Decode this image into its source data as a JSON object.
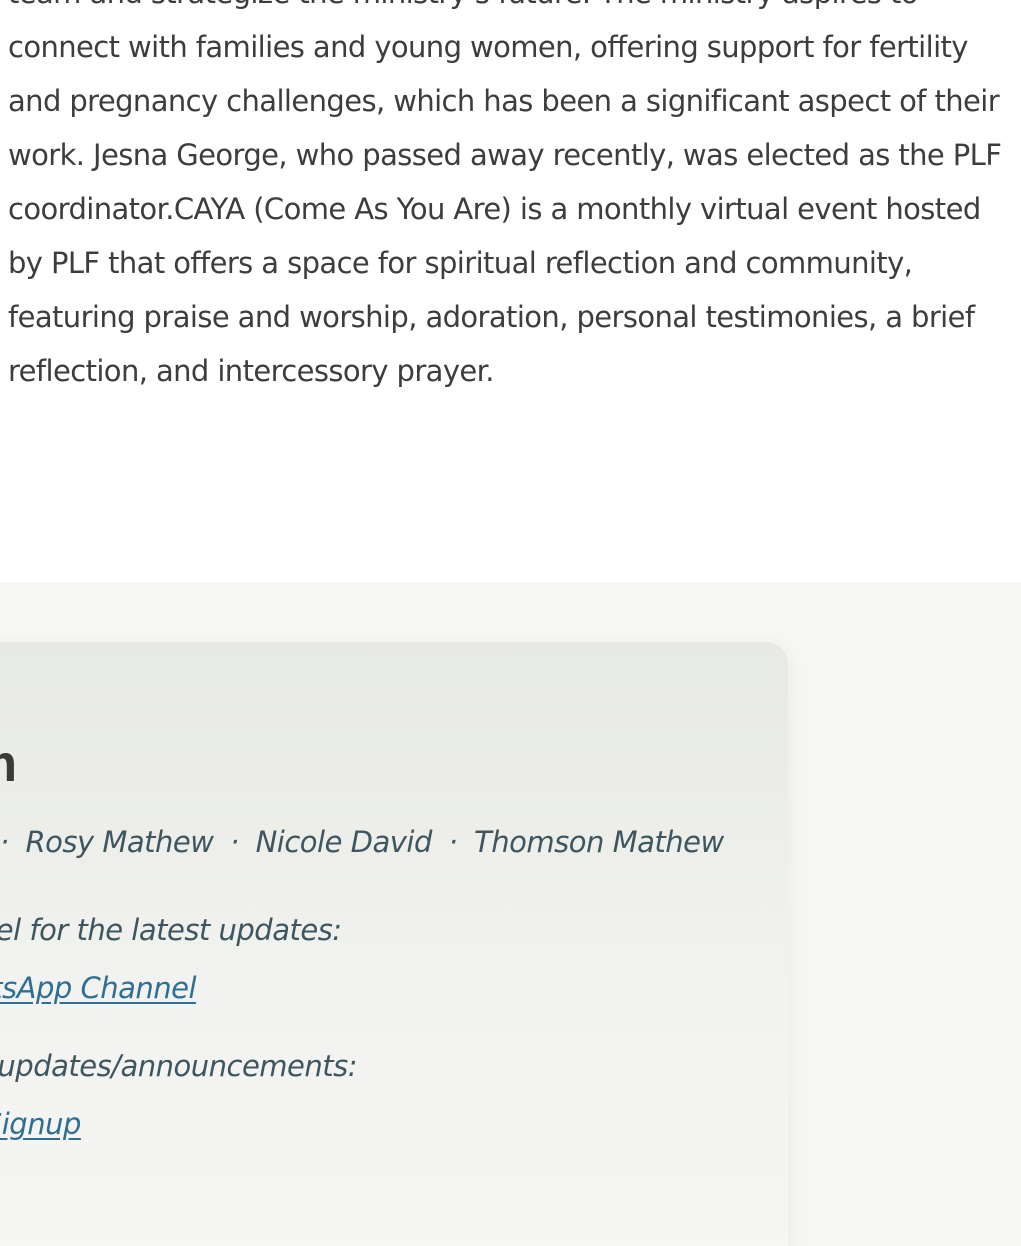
{
  "about": {
    "paragraph": "team and strategize the ministry’s future. The ministry aspires to connect with families and young women, offering support for fertility and pregnancy challenges, which has been a significant aspect of their work. Jesna George, who passed away recently, was elected as the PLF coordinator.CAYA (Come As You Are) is a monthly virtual event hosted by PLF that offers a space for spiritual reflection and community, featuring praise and worship, adoration, personal testimonies, a brief reflection, and intercessory prayer."
  },
  "team": {
    "title": "eam",
    "members": [
      "Rosy Mathew",
      "Nicole David",
      "Thomson Mathew"
    ],
    "separator": "·",
    "lead_separator": "·",
    "whatsapp_text": "nnel for the latest updates:",
    "whatsapp_link": "natsApp Channel",
    "email_text": "ar updates/announcements:",
    "email_link": "il Signup"
  }
}
